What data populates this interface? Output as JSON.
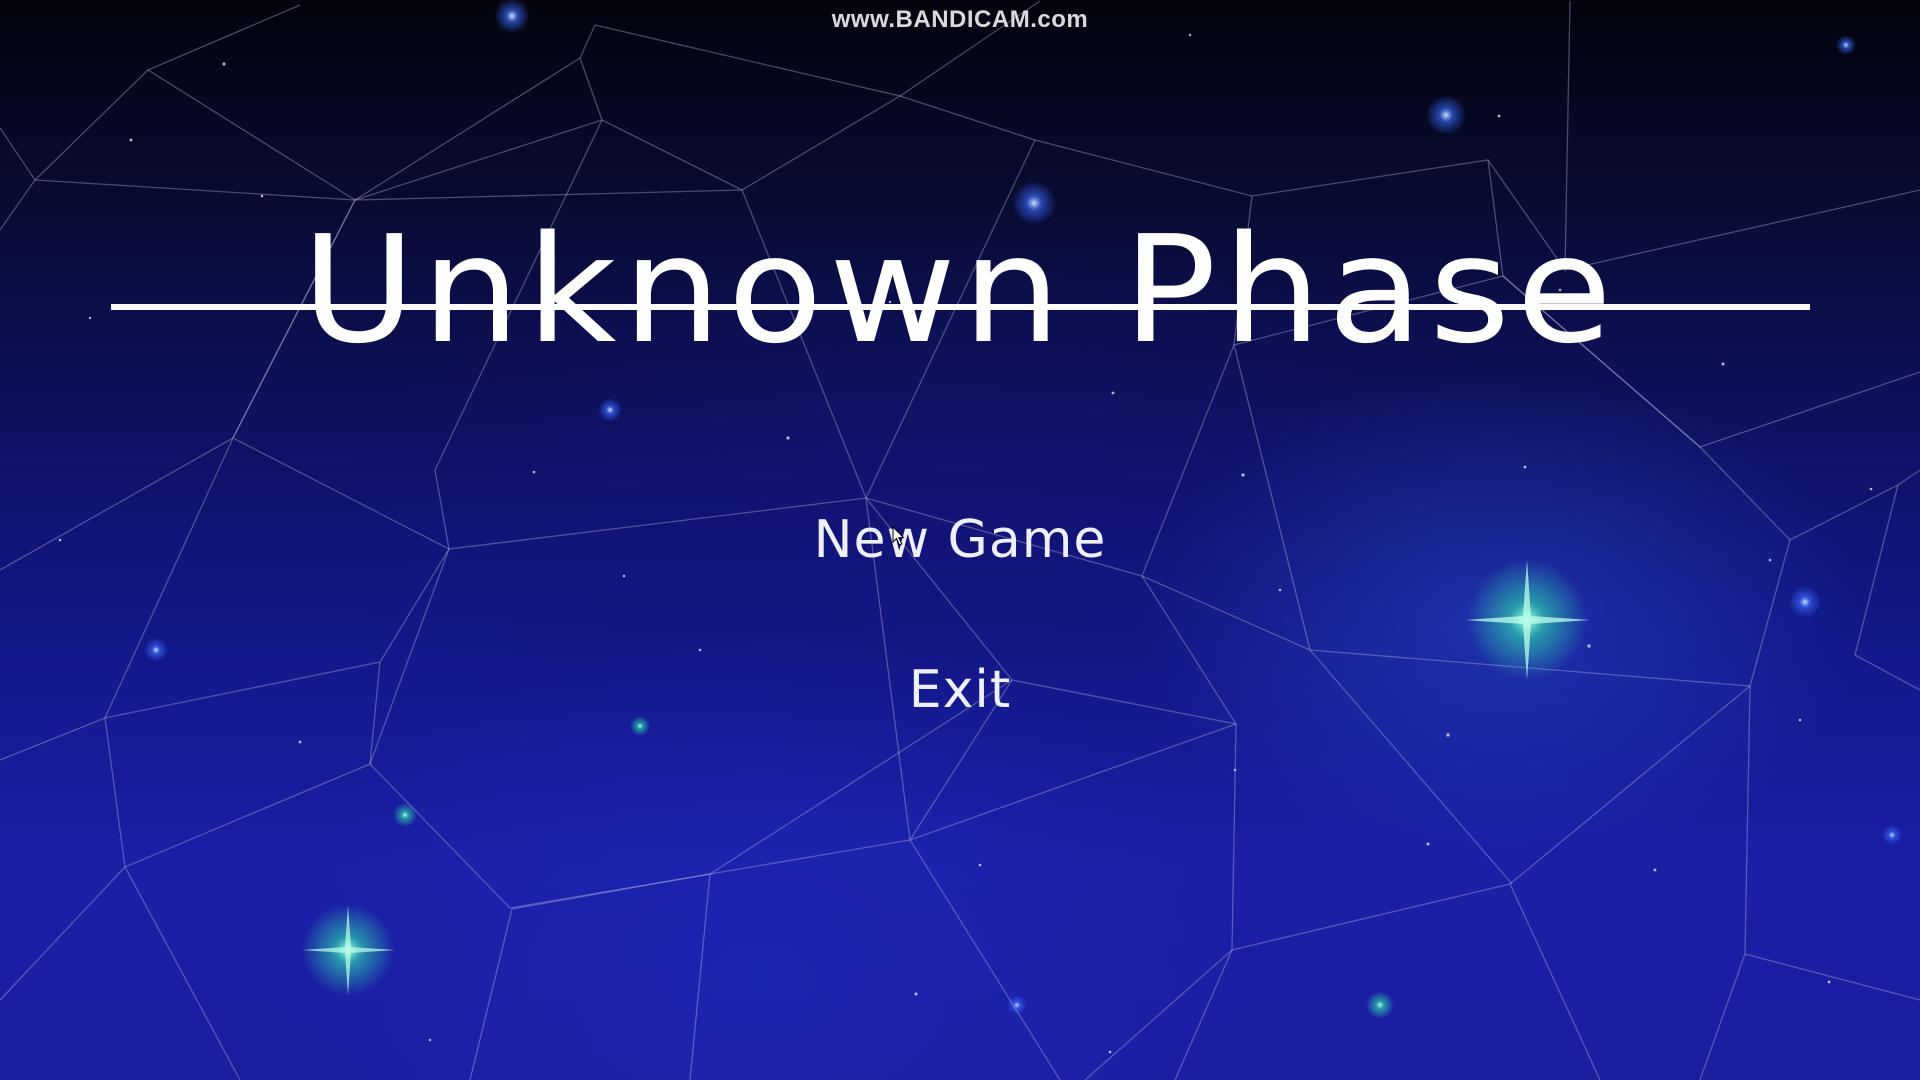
{
  "watermark": {
    "text": "www.BANDICAM.com"
  },
  "title": {
    "text": "Unknown Phase"
  },
  "menu": {
    "new_game_label": "New Game",
    "exit_label": "Exit"
  },
  "colors": {
    "text": "#ffffff",
    "background_dark": "#03040d",
    "background_blue": "#1a1fa6",
    "star_glow": "#3dffc8"
  },
  "icons": {
    "pointer": "mouse-cursor-icon"
  }
}
